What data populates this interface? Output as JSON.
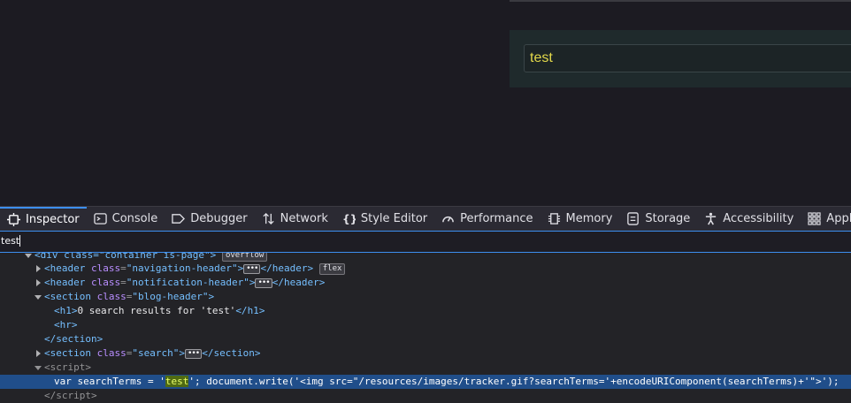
{
  "page": {
    "search_value": "test"
  },
  "toolbar": {
    "tabs": [
      {
        "label": "Inspector",
        "icon": "inspector-icon"
      },
      {
        "label": "Console",
        "icon": "console-icon"
      },
      {
        "label": "Debugger",
        "icon": "debugger-icon"
      },
      {
        "label": "Network",
        "icon": "network-icon"
      },
      {
        "label": "Style Editor",
        "icon": "style-editor-icon"
      },
      {
        "label": "Performance",
        "icon": "performance-icon"
      },
      {
        "label": "Memory",
        "icon": "memory-icon"
      },
      {
        "label": "Storage",
        "icon": "storage-icon"
      },
      {
        "label": "Accessibility",
        "icon": "accessibility-icon"
      },
      {
        "label": "Applicati",
        "icon": "application-icon"
      }
    ]
  },
  "filter": {
    "value": "test"
  },
  "tree": {
    "div_open": "<div class=\"container is-page\">",
    "overflow_badge": "overflow",
    "header_nav_tag": "header",
    "header_nav_attr": "class",
    "header_nav_val": "\"navigation-header\"",
    "flex_badge": "flex",
    "header_notif_val": "\"notification-header\"",
    "section_tag": "section",
    "section_blog_val": "\"blog-header\"",
    "h1_text": "0 search results for 'test'",
    "h1_tag": "h1",
    "hr_tag": "hr",
    "section_search_val": "\"search\"",
    "script_tag": "script",
    "script_pre": "var searchTerms = '",
    "script_match": "test",
    "script_post": "'; document.write('<img src=\"/resources/images/tracker.gif?searchTerms='+encodeURIComponent(searchTerms)+'\">');",
    "ellipsis": "•••"
  },
  "colors": {
    "accent": "#3d8ff0",
    "selected_row": "#204e8a",
    "tag": "#75bfff",
    "attr": "#b98eff",
    "search_text": "#e2d84a"
  }
}
